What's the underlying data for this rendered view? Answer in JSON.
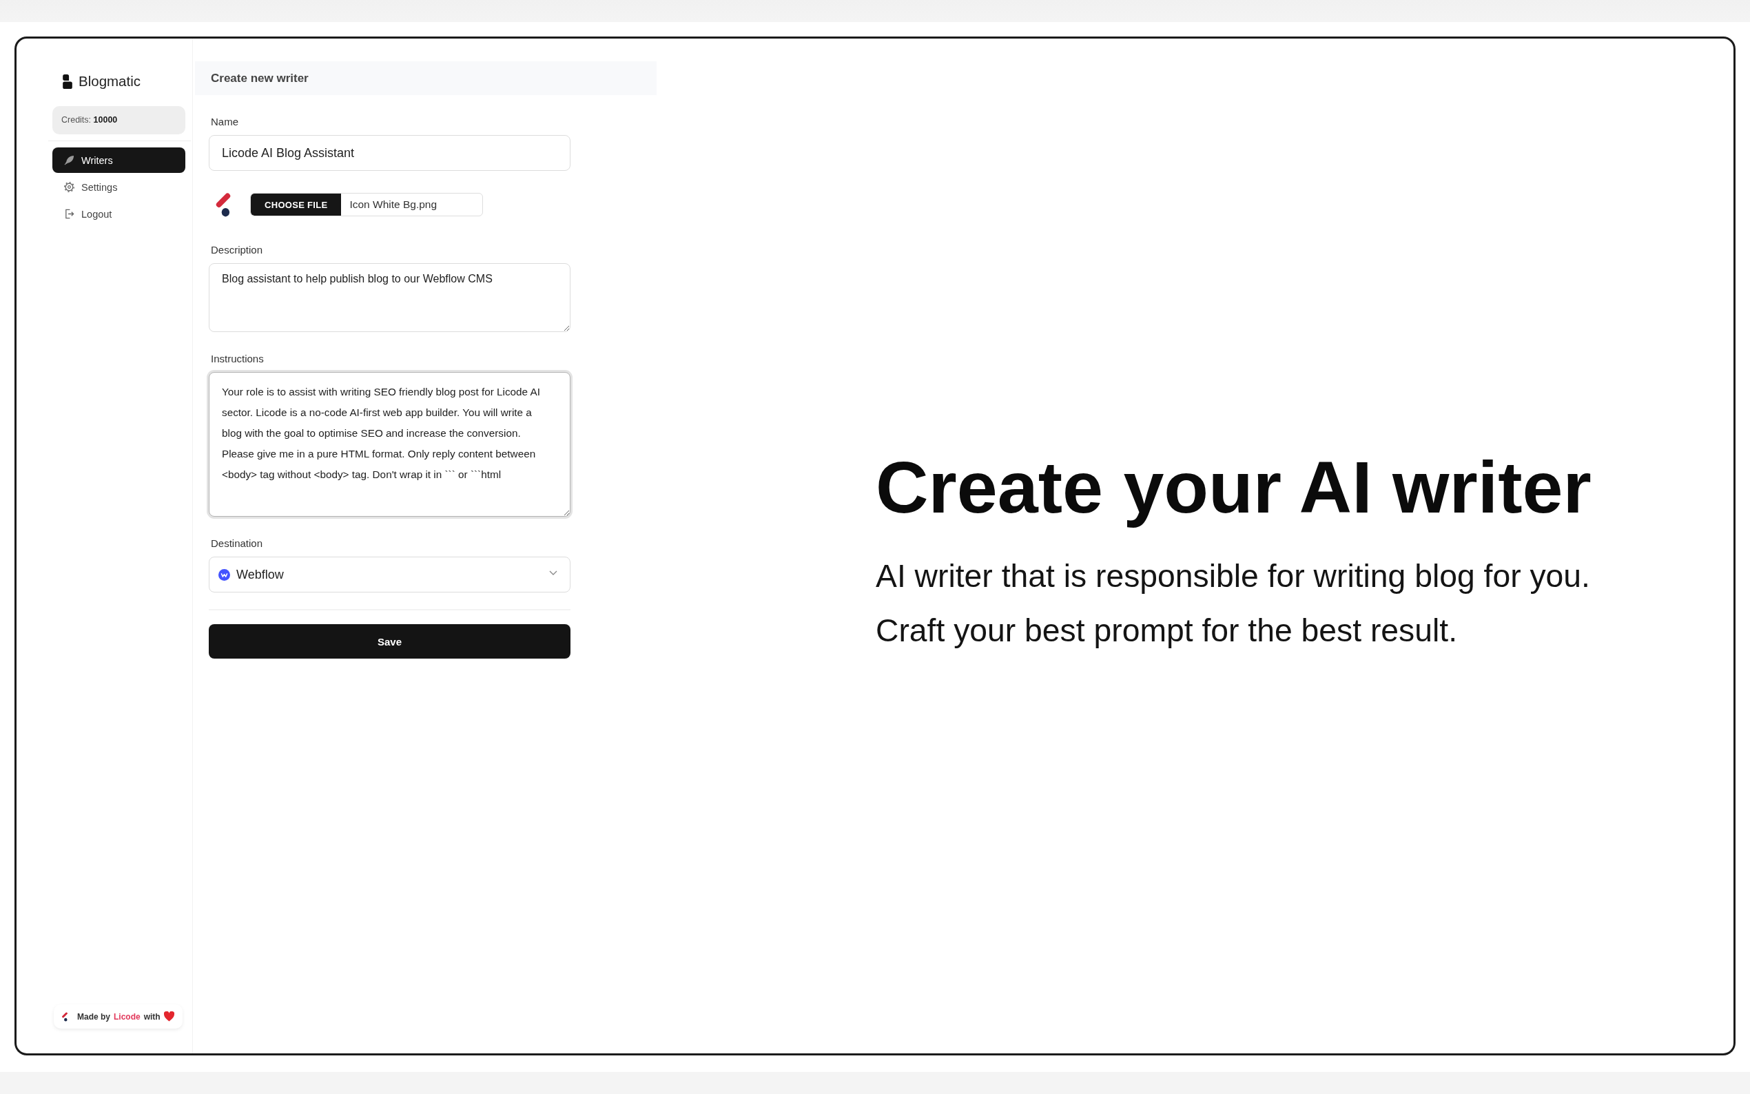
{
  "sidebar": {
    "brand": "Blogmatic",
    "credits": "Credits: **10000**",
    "nav": [
      {
        "label": "Writers",
        "selected": true
      },
      {
        "label": "Settings",
        "selected": false
      },
      {
        "label": "Logout",
        "selected": false
      }
    ],
    "footer": {
      "prefix": "Made by",
      "link": "Licode",
      "suffix": "with"
    }
  },
  "form": {
    "title": "Create new writer",
    "fields": [
      {
        "kind": "text",
        "label": "Name",
        "value": "Licode AI Blog Assistant",
        "focused": false
      },
      {
        "kind": "file",
        "button": "CHOOSE FILE",
        "filename": "Icon White Bg.png"
      },
      {
        "kind": "textarea",
        "label": "Description",
        "value": "Blog assistant to help publish blog to our Webflow CMS",
        "focused": false
      },
      {
        "kind": "textarea",
        "label": "Instructions",
        "value": "Your role is to assist with writing SEO friendly blog post for Licode AI sector. Licode is a no-code AI-first web app builder. You will write a blog with the goal to optimise SEO and increase the conversion. Please give me in a pure HTML format. Only reply content between <body> tag without <body> tag. Don't wrap it in ``` or ```html",
        "focused": true
      },
      {
        "kind": "select",
        "label": "Destination",
        "value": "Webflow"
      }
    ],
    "submit": "Save"
  },
  "hero": {
    "title": "Create your AI writer",
    "lines": [
      "AI writer that is responsible for writing blog for you.",
      "Craft your best prompt for the best result."
    ]
  }
}
